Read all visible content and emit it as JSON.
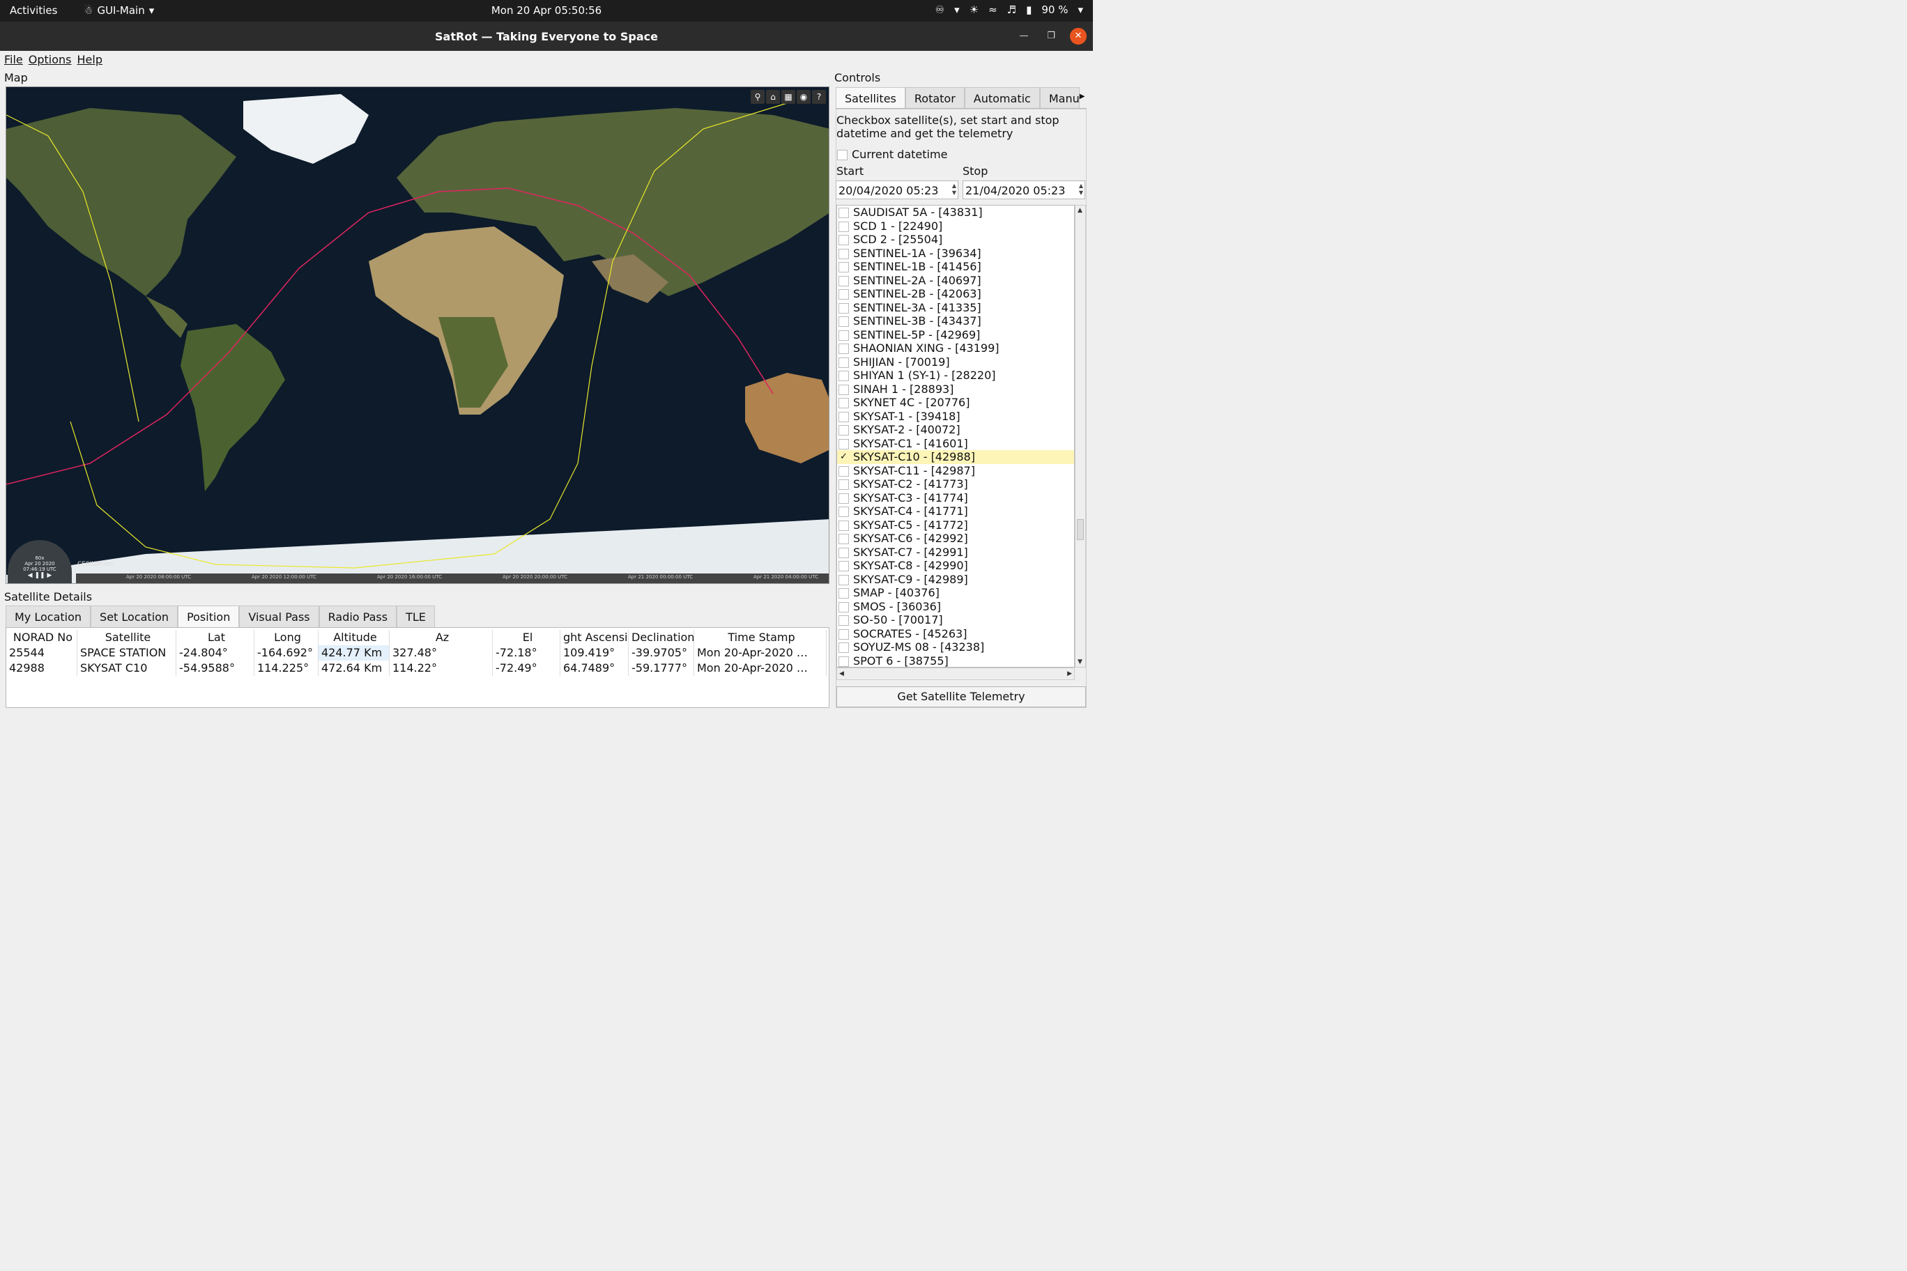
{
  "topbar": {
    "activities": "Activities",
    "app_name": "GUI-Main",
    "clock": "Mon 20 Apr  05:50:56",
    "battery": "90 %"
  },
  "window": {
    "title": "SatRot —  Taking Everyone to Space"
  },
  "menu": {
    "file": "File",
    "options": "Options",
    "help": "Help"
  },
  "map": {
    "label": "Map",
    "timeline": [
      "Apr 20 2020 08:00:00 UTC",
      "Apr 20 2020 12:00:00 UTC",
      "Apr 20 2020 16:00:00 UTC",
      "Apr 20 2020 20:00:00 UTC",
      "Apr 21 2020 00:00:00 UTC",
      "Apr 21 2020 04:00:00 UTC"
    ],
    "clock_speed": "60x",
    "clock_date": "Apr 20 2020",
    "clock_time": "07:46:19 UTC",
    "brand": "CESIUM ion"
  },
  "controls": {
    "label": "Controls",
    "tabs": [
      "Satellites",
      "Rotator",
      "Automatic",
      "Manu"
    ],
    "description": "Checkbox satellite(s), set start and stop datetime and get the telemetry",
    "current_datetime": "Current datetime",
    "start_label": "Start",
    "stop_label": "Stop",
    "start_value": "20/04/2020 05:23",
    "stop_value": "21/04/2020 05:23",
    "satellites": [
      {
        "name": "SAUDISAT 5A - [43831]",
        "checked": false
      },
      {
        "name": "SCD 1 - [22490]",
        "checked": false
      },
      {
        "name": "SCD 2 - [25504]",
        "checked": false
      },
      {
        "name": "SENTINEL-1A - [39634]",
        "checked": false
      },
      {
        "name": "SENTINEL-1B - [41456]",
        "checked": false
      },
      {
        "name": "SENTINEL-2A - [40697]",
        "checked": false
      },
      {
        "name": "SENTINEL-2B - [42063]",
        "checked": false
      },
      {
        "name": "SENTINEL-3A - [41335]",
        "checked": false
      },
      {
        "name": "SENTINEL-3B - [43437]",
        "checked": false
      },
      {
        "name": "SENTINEL-5P - [42969]",
        "checked": false
      },
      {
        "name": "SHAONIAN XING - [43199]",
        "checked": false
      },
      {
        "name": "SHIJIAN - [70019]",
        "checked": false
      },
      {
        "name": "SHIYAN 1 (SY-1) - [28220]",
        "checked": false
      },
      {
        "name": "SINAH 1 - [28893]",
        "checked": false
      },
      {
        "name": "SKYNET 4C - [20776]",
        "checked": false
      },
      {
        "name": "SKYSAT-1 - [39418]",
        "checked": false
      },
      {
        "name": "SKYSAT-2 - [40072]",
        "checked": false
      },
      {
        "name": "SKYSAT-C1 - [41601]",
        "checked": false
      },
      {
        "name": "SKYSAT-C10 - [42988]",
        "checked": true
      },
      {
        "name": "SKYSAT-C11 - [42987]",
        "checked": false
      },
      {
        "name": "SKYSAT-C2 - [41773]",
        "checked": false
      },
      {
        "name": "SKYSAT-C3 - [41774]",
        "checked": false
      },
      {
        "name": "SKYSAT-C4 - [41771]",
        "checked": false
      },
      {
        "name": "SKYSAT-C5 - [41772]",
        "checked": false
      },
      {
        "name": "SKYSAT-C6 - [42992]",
        "checked": false
      },
      {
        "name": "SKYSAT-C7 - [42991]",
        "checked": false
      },
      {
        "name": "SKYSAT-C8 - [42990]",
        "checked": false
      },
      {
        "name": "SKYSAT-C9 - [42989]",
        "checked": false
      },
      {
        "name": "SMAP - [40376]",
        "checked": false
      },
      {
        "name": "SMOS - [36036]",
        "checked": false
      },
      {
        "name": "SO-50 - [70017]",
        "checked": false
      },
      {
        "name": "SOCRATES - [45263]",
        "checked": false
      },
      {
        "name": "SOYUZ-MS 08 - [43238]",
        "checked": false
      },
      {
        "name": "SPOT 6 - [38755]",
        "checked": false
      }
    ],
    "button": "Get Satellite Telemetry"
  },
  "details": {
    "label": "Satellite Details",
    "tabs": [
      "My Location",
      "Set Location",
      "Position",
      "Visual Pass",
      "Radio Pass",
      "TLE"
    ],
    "columns": [
      "NORAD No",
      "Satellite",
      "Lat",
      "Long",
      "Altitude",
      "Az",
      "El",
      "ght Ascensic",
      "Declination",
      "Time Stamp"
    ],
    "rows": [
      [
        "25544",
        "SPACE STATION",
        "-24.804°",
        "-164.692°",
        "424.77 Km",
        "327.48°",
        "-72.18°",
        "109.419°",
        "-39.9705°",
        "Mon 20-Apr-2020 …"
      ],
      [
        "42988",
        "SKYSAT C10",
        "-54.9588°",
        "114.225°",
        "472.64 Km",
        "114.22°",
        "-72.49°",
        "64.7489°",
        "-59.1777°",
        "Mon 20-Apr-2020 …"
      ]
    ]
  }
}
